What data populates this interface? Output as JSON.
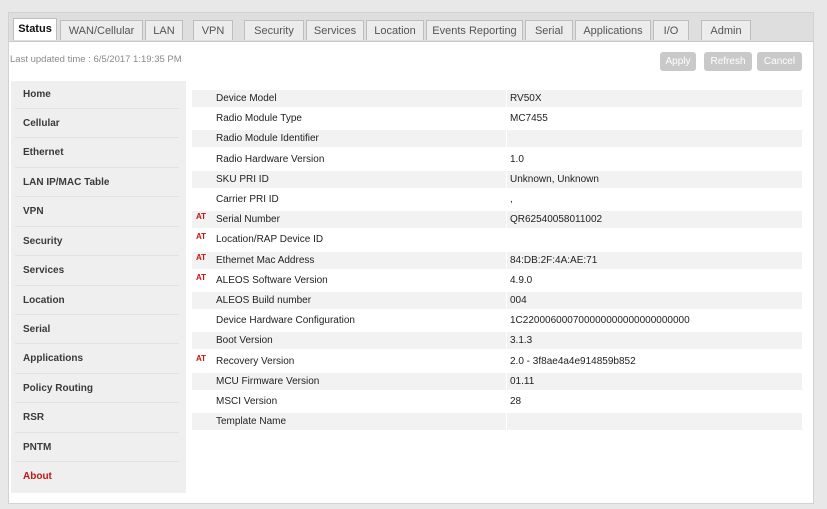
{
  "tabs": [
    {
      "label": "Status",
      "active": true
    },
    {
      "label": "WAN/Cellular",
      "active": false
    },
    {
      "label": "LAN",
      "active": false
    },
    {
      "label": "VPN",
      "active": false
    },
    {
      "label": "Security",
      "active": false
    },
    {
      "label": "Services",
      "active": false
    },
    {
      "label": "Location",
      "active": false
    },
    {
      "label": "Events Reporting",
      "active": false
    },
    {
      "label": "Serial",
      "active": false
    },
    {
      "label": "Applications",
      "active": false
    },
    {
      "label": "I/O",
      "active": false
    },
    {
      "label": "Admin",
      "active": false
    }
  ],
  "header": {
    "last_updated": "Last updated time : 6/5/2017 1:19:35 PM",
    "apply_label": "Apply",
    "refresh_label": "Refresh",
    "cancel_label": "Cancel"
  },
  "sidebar": {
    "items": [
      {
        "label": "Home",
        "active": false
      },
      {
        "label": "Cellular",
        "active": false
      },
      {
        "label": "Ethernet",
        "active": false
      },
      {
        "label": "LAN IP/MAC Table",
        "active": false
      },
      {
        "label": "VPN",
        "active": false
      },
      {
        "label": "Security",
        "active": false
      },
      {
        "label": "Services",
        "active": false
      },
      {
        "label": "Location",
        "active": false
      },
      {
        "label": "Serial",
        "active": false
      },
      {
        "label": "Applications",
        "active": false
      },
      {
        "label": "Policy Routing",
        "active": false
      },
      {
        "label": "RSR",
        "active": false
      },
      {
        "label": "PNTM",
        "active": false
      },
      {
        "label": "About",
        "active": true
      }
    ]
  },
  "about_table": {
    "at_marker": "AT",
    "rows": [
      {
        "label": "Device Model",
        "value": "RV50X",
        "at": false
      },
      {
        "label": "Radio Module Type",
        "value": "MC7455",
        "at": false
      },
      {
        "label": "Radio Module Identifier",
        "value": "",
        "at": false
      },
      {
        "label": "Radio Hardware Version",
        "value": "1.0",
        "at": false
      },
      {
        "label": "SKU PRI ID",
        "value": "Unknown, Unknown",
        "at": false
      },
      {
        "label": "Carrier PRI ID",
        "value": ",",
        "at": false
      },
      {
        "label": "Serial Number",
        "value": "QR62540058011002",
        "at": true
      },
      {
        "label": "Location/RAP Device ID",
        "value": "",
        "at": true
      },
      {
        "label": "Ethernet Mac Address",
        "value": "84:DB:2F:4A:AE:71",
        "at": true
      },
      {
        "label": "ALEOS Software Version",
        "value": "4.9.0",
        "at": true
      },
      {
        "label": "ALEOS Build number",
        "value": "004",
        "at": false
      },
      {
        "label": "Device Hardware Configuration",
        "value": "1C220006000700000000000000000000",
        "at": false
      },
      {
        "label": "Boot Version",
        "value": "3.1.3",
        "at": false
      },
      {
        "label": "Recovery Version",
        "value": "2.0 - 3f8ae4a4e914859b852",
        "at": true
      },
      {
        "label": "MCU Firmware Version",
        "value": "01.11",
        "at": false
      },
      {
        "label": "MSCI Version",
        "value": "28",
        "at": false
      },
      {
        "label": "Template Name",
        "value": "",
        "at": false
      }
    ]
  },
  "colors": {
    "accent_red": "#c21818",
    "button_gray": "#c9c9c9"
  }
}
